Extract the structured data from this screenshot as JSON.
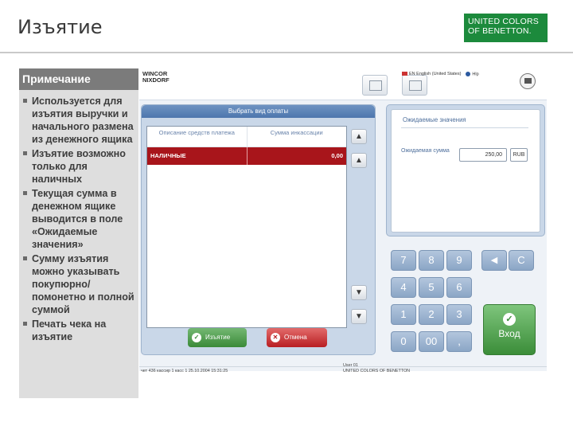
{
  "slide": {
    "title": "Изъятие",
    "brand": "UNITED COLORS OF BENETTON."
  },
  "notes": {
    "heading": "Примечание",
    "items": [
      "Используется для изъятия выручки и начального размена из денежного ящика",
      "Изъятие возможно только для наличных",
      "Текущая сумма в денежном ящике выводится в поле «Ожидаемые значения»",
      "Сумму изъятия можно указывать покупюрно/ помонетно и полной суммой",
      "Печать чека на изъятие"
    ]
  },
  "pos": {
    "logo_line1": "WINCOR",
    "logo_line2": "NIXDORF",
    "language": "EN English (United States)",
    "help": "Hlp",
    "payment_panel": {
      "title": "Выбрать вид оплаты",
      "col_description": "Описание средств платежа",
      "col_amount": "Сумма инкассации",
      "rows": [
        {
          "description": "НАЛИЧНЫЕ",
          "amount": "0,00"
        }
      ]
    },
    "buttons": {
      "withdraw": "Изъятие",
      "cancel": "Отмена"
    },
    "expected": {
      "title": "Ожидаемые значения",
      "label": "Ожидаемая сумма",
      "amount": "250,00",
      "currency": "RUB"
    },
    "keypad": {
      "keys": [
        "7",
        "8",
        "9",
        "4",
        "5",
        "6",
        "1",
        "2",
        "3",
        "0",
        "00",
        ","
      ],
      "back": "◀",
      "clear": "C",
      "enter": "Вход"
    },
    "status": {
      "left": "чет 436   кассир 1   касс 1   25.10.2004   15:31:25",
      "user": "User 01",
      "company": "UNITED COLORS OF BENETTON"
    }
  },
  "colors": {
    "brand_green": "#1c8a3c",
    "selected_row": "#a8151b",
    "ok_green": "#3a8a38",
    "cancel_red": "#b81e22",
    "keypad_blue": "#8ba6c6"
  }
}
